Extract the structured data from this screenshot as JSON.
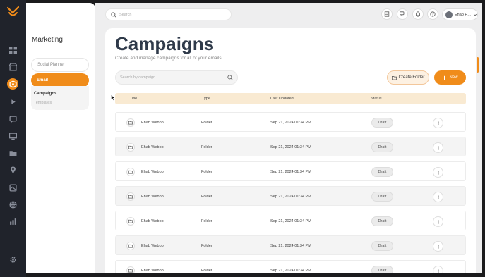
{
  "topbar": {
    "search_placeholder": "Search",
    "user_name": "Ehab H..."
  },
  "sidebar": {
    "title": "Marketing",
    "items": [
      {
        "label": "Social Planner"
      },
      {
        "label": "Email"
      }
    ],
    "subitems": [
      {
        "label": "Campaigns"
      },
      {
        "label": "Templates"
      }
    ]
  },
  "main": {
    "title": "Campaigns",
    "subtitle": "Create and manage campaigns for all of your emails",
    "search_placeholder": "Search by campaign",
    "create_folder_label": "Create Folder",
    "new_label": "New"
  },
  "table": {
    "columns": [
      "Title",
      "Type",
      "Last Updated",
      "Status"
    ],
    "rows": [
      {
        "title": "Ehab Webbb",
        "type": "Folder",
        "updated": "Sep 21, 2024 01:34 PM",
        "status": "Draft"
      },
      {
        "title": "Ehab Webbb",
        "type": "Folder",
        "updated": "Sep 21, 2024 01:34 PM",
        "status": "Draft"
      },
      {
        "title": "Ehab Webbb",
        "type": "Folder",
        "updated": "Sep 21, 2024 01:34 PM",
        "status": "Draft"
      },
      {
        "title": "Ehab Webbb",
        "type": "Folder",
        "updated": "Sep 21, 2024 01:34 PM",
        "status": "Draft"
      },
      {
        "title": "Ehab Webbb",
        "type": "Folder",
        "updated": "Sep 21, 2024 01:34 PM",
        "status": "Draft"
      },
      {
        "title": "Ehab Webbb",
        "type": "Folder",
        "updated": "Sep 21, 2024 01:34 PM",
        "status": "Draft"
      },
      {
        "title": "Ehab Webbb",
        "type": "Folder",
        "updated": "Sep 21, 2024 01:34 PM",
        "status": "Draft"
      }
    ]
  },
  "colors": {
    "accent": "#f08c1a",
    "rail": "#20232b",
    "title": "#2f3a4a",
    "header_row": "#f9ead2"
  },
  "icons": {
    "rail": [
      "dashboard-icon",
      "store-icon",
      "marketing-icon",
      "play-icon",
      "chat-icon",
      "monitor-icon",
      "folder-icon",
      "location-icon",
      "media-icon",
      "globe-icon",
      "chart-icon",
      "settings-icon"
    ],
    "topbar": [
      "building-icon",
      "messages-icon",
      "bell-icon",
      "help-icon"
    ]
  }
}
